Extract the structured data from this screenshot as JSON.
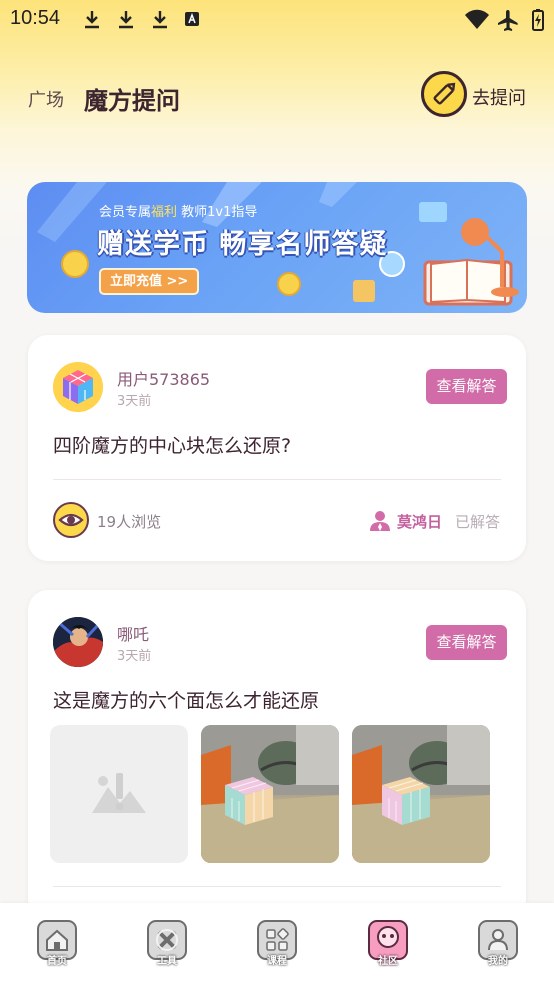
{
  "status_bar": {
    "time": "10:54"
  },
  "header": {
    "tab_plaza": "广场",
    "tab_ask": "魔方提问",
    "ask_button": "去提问"
  },
  "banner": {
    "subtitle_a": "会员专属",
    "subtitle_highlight": "福利",
    "subtitle_b": " 教师1v1指导",
    "title": "赠送学币 畅享名师答疑",
    "cta": "立即充值 >>"
  },
  "posts": [
    {
      "user": "用户573865",
      "time": "3天前",
      "action": "查看解答",
      "question": "四阶魔方的中心块怎么还原?",
      "views": "19人浏览",
      "answerer": "莫鸿日",
      "status": "已解答"
    },
    {
      "user": "哪吒",
      "time": "3天前",
      "action": "查看解答",
      "question": "这是魔方的六个面怎么才能还原"
    }
  ],
  "bottom_nav": {
    "items": [
      {
        "label": "首页",
        "icon": "home-icon"
      },
      {
        "label": "工具",
        "icon": "tools-icon"
      },
      {
        "label": "课程",
        "icon": "course-icon"
      },
      {
        "label": "社区",
        "icon": "community-icon",
        "active": true
      },
      {
        "label": "我的",
        "icon": "profile-icon"
      }
    ]
  },
  "colors": {
    "accent_pink": "#d16ca8",
    "accent_yellow": "#fcd94b",
    "text_dark": "#3d2530"
  }
}
